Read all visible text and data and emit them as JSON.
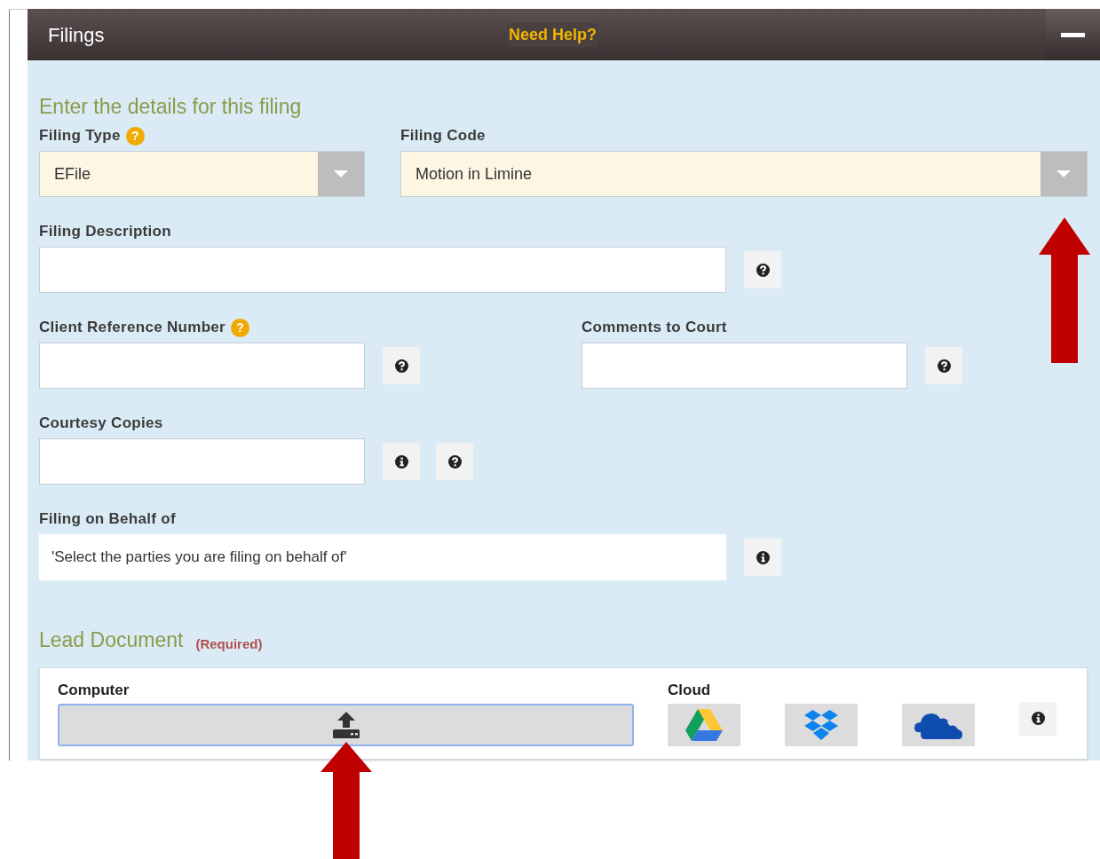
{
  "panel": {
    "title": "Filings",
    "help_link": "Need Help?"
  },
  "section_title": "Enter the details for this filing",
  "rows": [
    {
      "fields": [
        {
          "label": "Filing Type",
          "badge": "?",
          "kind": "select",
          "value": "EFile"
        },
        {
          "label": "Filing Code",
          "kind": "select",
          "value": "Motion in Limine"
        }
      ]
    },
    {
      "fields": [
        {
          "label": "Filing Description",
          "kind": "input",
          "buttons": [
            {
              "kind": "help"
            }
          ]
        }
      ]
    },
    {
      "fields": [
        {
          "label": "Client Reference Number",
          "badge": "?",
          "kind": "input",
          "buttons": [
            {
              "kind": "help"
            }
          ]
        },
        {
          "label": "Comments to Court",
          "kind": "input",
          "buttons": [
            {
              "kind": "help"
            }
          ]
        }
      ]
    },
    {
      "fields": [
        {
          "label": "Courtesy Copies",
          "kind": "input",
          "buttons": [
            {
              "kind": "info"
            },
            {
              "kind": "help"
            }
          ]
        }
      ]
    },
    {
      "fields": [
        {
          "label": "Filing on Behalf of",
          "kind": "picker",
          "placeholder": "'Select the parties you are filing on behalf of'",
          "buttons": [
            {
              "kind": "info"
            }
          ]
        }
      ]
    }
  ],
  "lead_document": {
    "title": "Lead Document",
    "note": "(Required)",
    "computer_label": "Computer",
    "cloud_label": "Cloud",
    "cloud_services": [
      {
        "kind": "drive"
      },
      {
        "kind": "dropbox"
      },
      {
        "kind": "onedrive"
      }
    ]
  }
}
